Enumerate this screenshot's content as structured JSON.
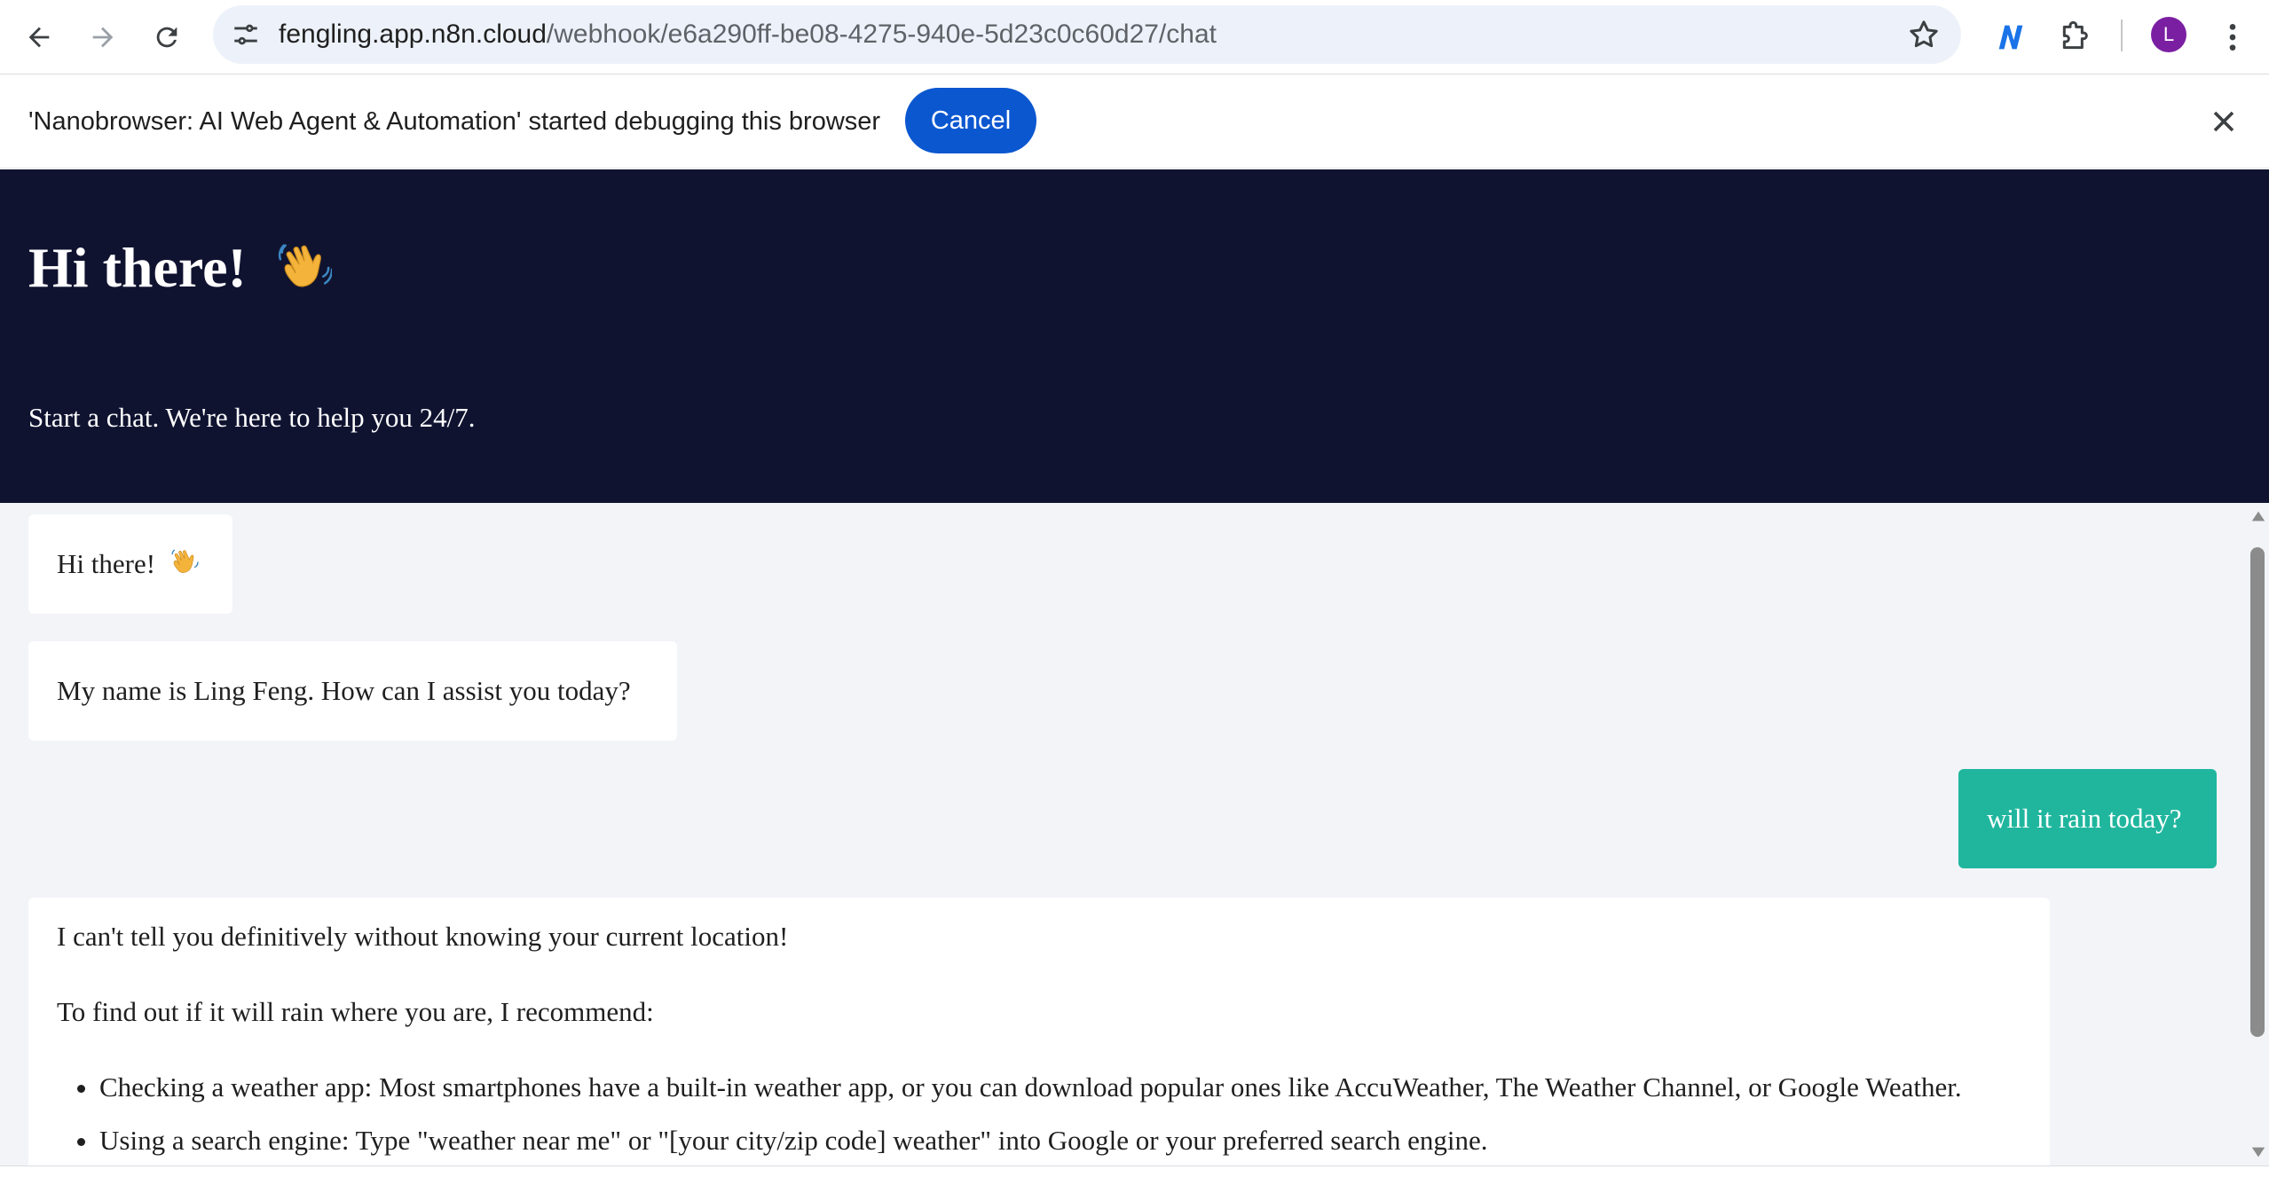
{
  "browser": {
    "url_host": "fengling.app.n8n.cloud",
    "url_path": "/webhook/e6a290ff-be08-4275-940e-5d23c0c60d27/chat",
    "profile_initial": "L",
    "icons": {
      "back": "back-arrow-icon",
      "forward": "forward-arrow-icon",
      "reload": "reload-icon",
      "site_settings": "tune-icon",
      "bookmark": "star-icon",
      "nanobrowser": "nanobrowser-extension-icon",
      "extensions": "puzzle-icon",
      "menu": "kebab-menu-icon"
    },
    "accent_color": "#0b57d0",
    "profile_color": "#7b1fa2"
  },
  "infobar": {
    "message": "'Nanobrowser: AI Web Agent & Automation' started debugging this browser",
    "cancel_label": "Cancel"
  },
  "chat": {
    "header_title": "Hi there!",
    "header_subtitle": "Start a chat. We're here to help you 24/7.",
    "header_color": "#101330",
    "user_bubble_color": "#20b69e",
    "messages": [
      {
        "role": "bot",
        "text": "Hi there!"
      },
      {
        "role": "bot",
        "text": "My name is Ling Feng. How can I assist you today?"
      },
      {
        "role": "user",
        "text": "will it rain today?"
      },
      {
        "role": "bot",
        "paragraphs": [
          "I can't tell you definitively without knowing your current location!",
          "To find out if it will rain where you are, I recommend:"
        ],
        "bullets": [
          "Checking a weather app: Most smartphones have a built-in weather app, or you can download popular ones like AccuWeather, The Weather Channel, or Google Weather.",
          "Using a search engine: Type \"weather near me\" or \"[your city/zip code] weather\" into Google or your preferred search engine."
        ]
      }
    ]
  }
}
